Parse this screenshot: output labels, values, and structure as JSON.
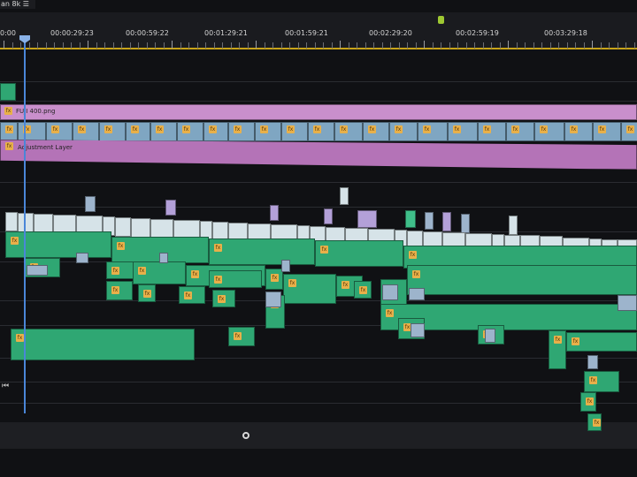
{
  "sequence_tab": {
    "label": "an 8k"
  },
  "ruler": {
    "timecodes": [
      "0:00",
      "00:00:29:23",
      "00:00:59:22",
      "00:01:29:21",
      "00:01:59:21",
      "00:02:29:20",
      "00:02:59:19",
      "00:03:29:18"
    ]
  },
  "tracks": {
    "v3_clip_name": "FUJI 400.png",
    "v2_clip_name": "Adjustment Layer",
    "fx_badge": "fx"
  },
  "colors": {
    "adjustment_layer": "#c98fcc",
    "nested_clip": "#7fa6c2",
    "audio_clip": "#2fa773",
    "video_clip": "#d6e3e8",
    "playhead": "#4a86d8",
    "work_area_bar": "#c8a318"
  },
  "icons": {
    "fx_badge": "fx-icon",
    "playhead": "playhead-icon",
    "scroll_handle": "scroll-handle-icon",
    "transport": "step-back-icon"
  }
}
